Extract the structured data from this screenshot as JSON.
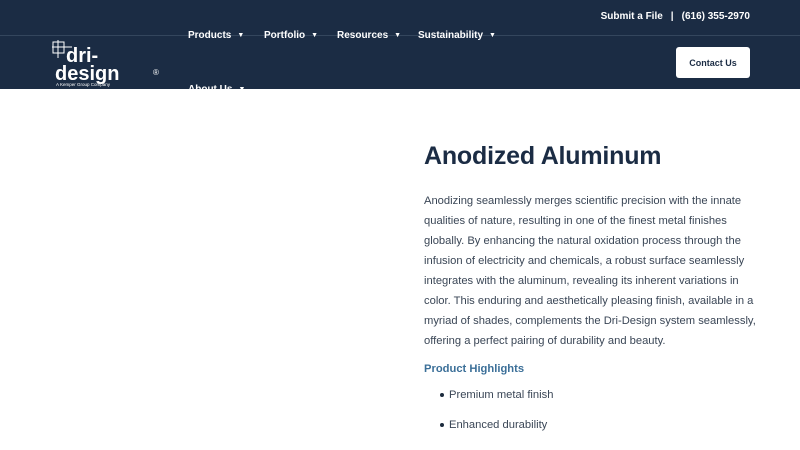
{
  "topbar": {
    "submit_file": "Submit a File",
    "separator": "|",
    "phone": "(616) 355-2970"
  },
  "logo": {
    "line1": "dri-",
    "line2": "design",
    "registered": "®",
    "tagline": "A Kemper Group Company"
  },
  "nav": {
    "items": [
      {
        "label": "Products"
      },
      {
        "label": "Portfolio"
      },
      {
        "label": "Resources"
      },
      {
        "label": "Sustainability"
      },
      {
        "label": "About Us"
      }
    ],
    "chevron_icon": "chevron-down-icon",
    "contact_label": "Contact Us"
  },
  "main": {
    "title": "Anodized Aluminum",
    "description": "Anodizing seamlessly merges scientific precision with the innate qualities of nature, resulting in one of the finest metal finishes globally. By enhancing the natural oxidation process through the infusion of electricity and chemicals, a robust surface seamlessly integrates with the aluminum, revealing its inherent variations in color. This enduring and aesthetically pleasing finish, available in a myriad of shades, complements the Dri-Design system seamlessly, offering a perfect pairing of durability and beauty.",
    "highlights_heading": "Product Highlights",
    "highlights": [
      "Premium metal finish",
      "Enhanced durability"
    ]
  },
  "colors": {
    "header_bg": "#1b2c44",
    "accent": "#3b6f98"
  }
}
